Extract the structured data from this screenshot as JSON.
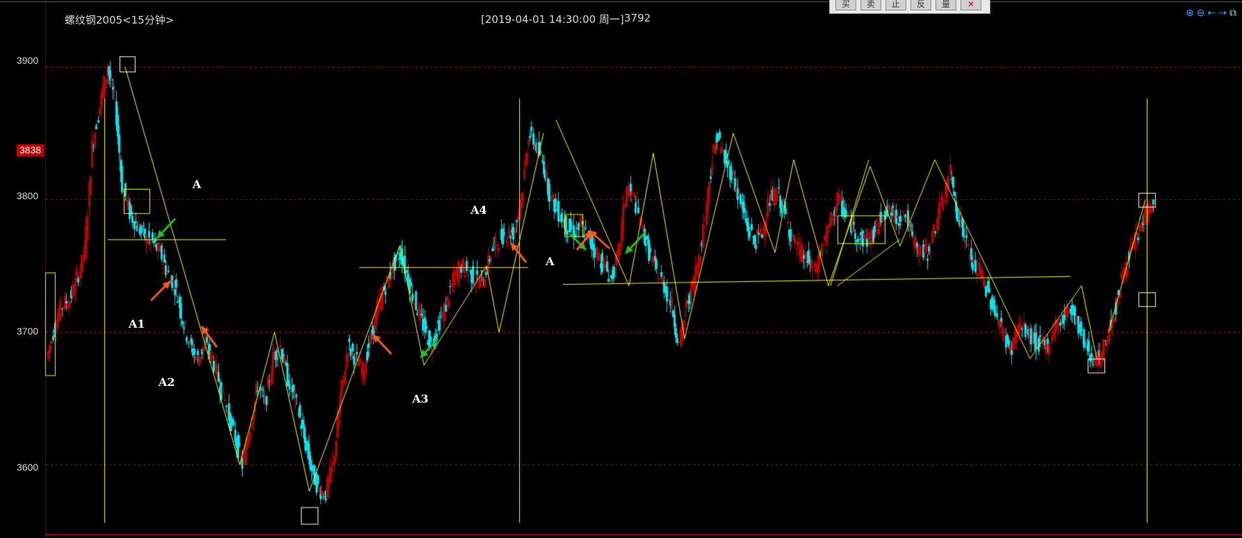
{
  "header": {
    "title": "螺纹钢2005<15分钟>",
    "datetime": "[2019-04-01  14:30:00 周一]",
    "value": "3792"
  },
  "toolbar": [
    "买",
    "卖",
    "止",
    "反",
    "量"
  ],
  "colors": {
    "background": "#000000",
    "up_candle": "#c00000",
    "down_candle": "#00e5ee",
    "trendline": "#ffff00",
    "grid": "#c00000",
    "box_white": "#ffffff",
    "arrow_green": "#22c322",
    "arrow_orange": "#ff5a1f",
    "current_badge": "#c00000"
  },
  "chart_data": {
    "type": "candlestick",
    "title": "螺纹钢2005<15分钟>",
    "ylim": [
      3550,
      3940
    ],
    "yticks": [
      3600,
      3700,
      3800,
      3900
    ],
    "current_price": 3838,
    "grid": true,
    "series": [
      {
        "values": [
          3680,
          3705,
          3720,
          3725,
          3740,
          3760,
          3840,
          3870,
          3900,
          3875,
          3810,
          3790,
          3780,
          3772,
          3768,
          3760,
          3745,
          3735,
          3710,
          3690,
          3680,
          3690,
          3680,
          3660,
          3640,
          3620,
          3600,
          3630,
          3660,
          3645,
          3680,
          3690,
          3665,
          3650,
          3625,
          3600,
          3582,
          3578,
          3600,
          3650,
          3690,
          3680,
          3670,
          3695,
          3720,
          3735,
          3750,
          3760,
          3740,
          3720,
          3705,
          3690,
          3705,
          3720,
          3740,
          3750,
          3745,
          3740,
          3740,
          3760,
          3770,
          3775,
          3775,
          3800,
          3850,
          3840,
          3825,
          3800,
          3790,
          3780,
          3775,
          3780,
          3770,
          3760,
          3750,
          3740,
          3760,
          3810,
          3800,
          3780,
          3760,
          3745,
          3735,
          3720,
          3690,
          3720,
          3740,
          3770,
          3815,
          3850,
          3830,
          3820,
          3800,
          3780,
          3768,
          3775,
          3800,
          3805,
          3790,
          3770,
          3760,
          3755,
          3745,
          3765,
          3780,
          3800,
          3790,
          3780,
          3770,
          3770,
          3775,
          3790,
          3790,
          3785,
          3790,
          3770,
          3760,
          3760,
          3780,
          3800,
          3820,
          3790,
          3770,
          3750,
          3745,
          3730,
          3715,
          3700,
          3685,
          3705,
          3700,
          3695,
          3690,
          3690,
          3705,
          3710,
          3720,
          3705,
          3690,
          3680,
          3680,
          3700,
          3720,
          3745,
          3760,
          3775,
          3790,
          3798
        ]
      }
    ],
    "annotations": [
      "A",
      "A1",
      "A2",
      "A3",
      "A4",
      "A"
    ]
  }
}
